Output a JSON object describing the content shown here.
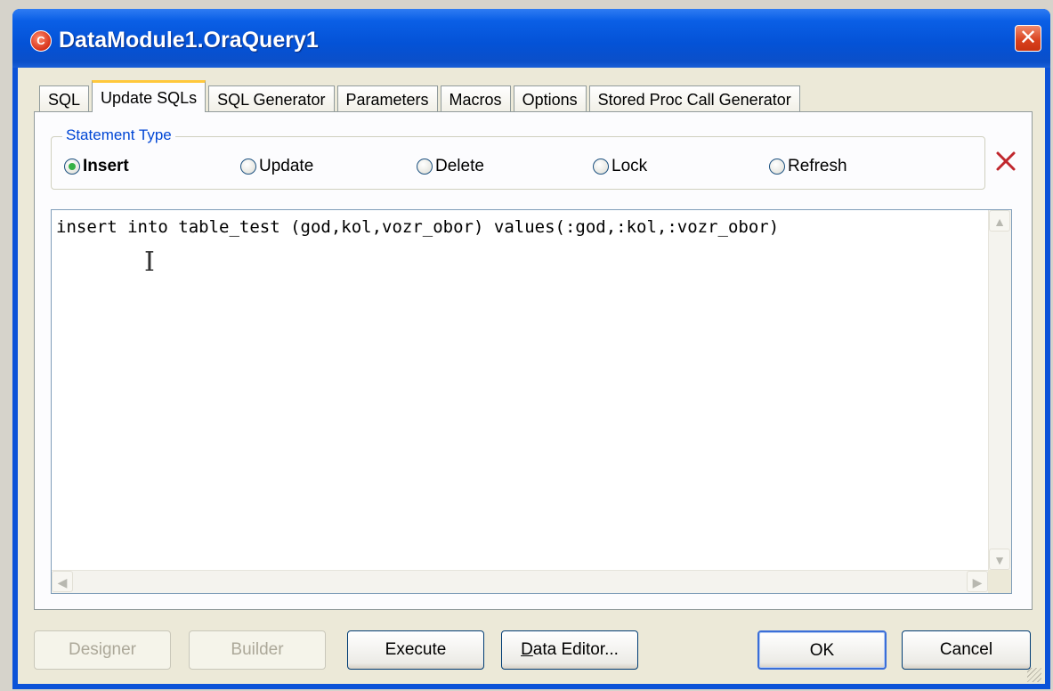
{
  "window": {
    "title": "DataModule1.OraQuery1",
    "close_glyph": "✕",
    "app_icon": "devart-app-icon"
  },
  "tabs": [
    {
      "label": "SQL",
      "active": false
    },
    {
      "label": "Update SQLs",
      "active": true
    },
    {
      "label": "SQL Generator",
      "active": false
    },
    {
      "label": "Parameters",
      "active": false
    },
    {
      "label": "Macros",
      "active": false
    },
    {
      "label": "Options",
      "active": false
    },
    {
      "label": "Stored Proc Call Generator",
      "active": false
    }
  ],
  "statement_type": {
    "legend": "Statement Type",
    "options": [
      {
        "label": "Insert",
        "checked": true
      },
      {
        "label": "Update",
        "checked": false
      },
      {
        "label": "Delete",
        "checked": false
      },
      {
        "label": "Lock",
        "checked": false
      },
      {
        "label": "Refresh",
        "checked": false
      }
    ],
    "clear_icon": "red-x-icon"
  },
  "editor": {
    "text": "insert into table_test (god,kol,vozr_obor) values(:god,:kol,:vozr_obor)"
  },
  "buttons": {
    "designer": "Designer",
    "builder": "Builder",
    "execute": "Execute",
    "data_editor_accel": "D",
    "data_editor_rest": "ata Editor...",
    "ok": "OK",
    "cancel": "Cancel"
  },
  "colors": {
    "title_bar": "#0452d6",
    "tab_highlight": "#ffc83c",
    "legend_text": "#0046d5",
    "radio_check": "#35b145",
    "clear_icon": "#c0272d"
  }
}
